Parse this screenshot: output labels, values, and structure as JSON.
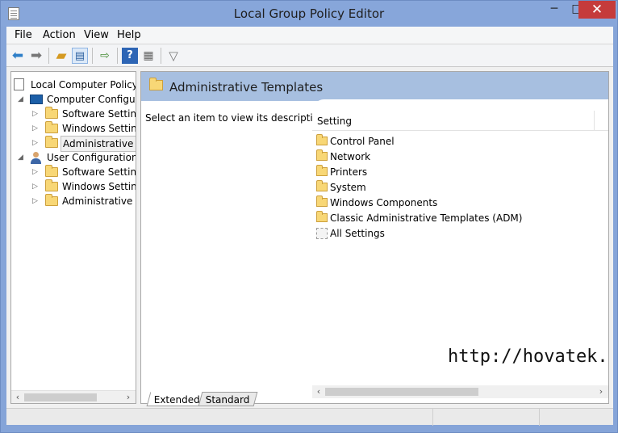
{
  "window": {
    "title": "Local Group Policy Editor",
    "minimize_glyph": "─",
    "maximize_glyph": "□",
    "close_glyph": "✕"
  },
  "menu": [
    "File",
    "Action",
    "View",
    "Help"
  ],
  "toolbar": {
    "back_icon": "back-arrow-icon",
    "forward_icon": "forward-arrow-icon",
    "up_icon": "folder-up-icon",
    "show_hide_icon": "console-tree-icon",
    "export_icon": "export-list-icon",
    "help_icon": "help-icon",
    "properties_icon": "properties-icon",
    "filter_icon": "filter-icon"
  },
  "tree": {
    "root": "Local Computer Policy",
    "computer_config": "Computer Configura",
    "computer_children": [
      "Software Settings",
      "Windows Setting",
      "Administrative Te"
    ],
    "user_config": "User Configuration",
    "user_children": [
      "Software Settings",
      "Windows Setting",
      "Administrative Te"
    ]
  },
  "content": {
    "header_title": "Administrative Templates",
    "description": "Select an item to view its description.",
    "column_header": "Setting",
    "items": [
      "Control Panel",
      "Network",
      "Printers",
      "System",
      "Windows Components",
      "Classic Administrative Templates (ADM)",
      "All Settings"
    ],
    "watermark": "http://hovatek.com"
  },
  "tabs": [
    "Extended",
    "Standard"
  ],
  "colors": {
    "title_bar": "#87a6da",
    "close_button": "#c53b3b",
    "header_band": "#a7bfe0",
    "folder": "#f8d776"
  }
}
